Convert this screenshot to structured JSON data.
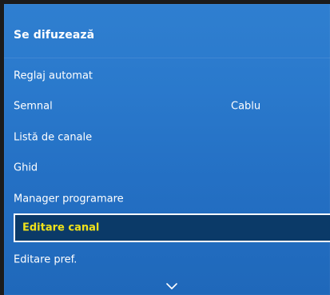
{
  "menu": {
    "title": "Se difuzează",
    "items": [
      {
        "label": "Reglaj automat",
        "value": ""
      },
      {
        "label": "Semnal",
        "value": "Cablu"
      },
      {
        "label": "Listă de canale",
        "value": ""
      },
      {
        "label": "Ghid",
        "value": ""
      },
      {
        "label": "Manager programare",
        "value": ""
      },
      {
        "label": "Editare canal",
        "value": ""
      },
      {
        "label": "Editare pref.",
        "value": ""
      }
    ],
    "selected_index": 5,
    "scroll_icon": "chevron-down-icon"
  },
  "colors": {
    "panel": "#2a79cc",
    "selected_bg": "#0b3a68",
    "selected_text": "#f0e21a",
    "text": "#ffffff"
  }
}
